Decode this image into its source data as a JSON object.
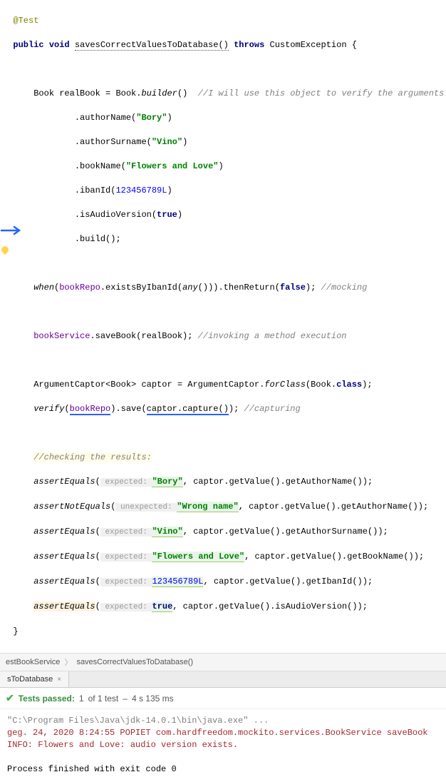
{
  "code": {
    "annotation": "@Test",
    "modifiers": "public void",
    "method_name": "savesCorrectValuesToDatabase()",
    "throws_kw": "throws",
    "exception": "CustomException",
    "brace_open": "{",
    "l1_a": "Book realBook = Book.",
    "l1_b": "builder",
    "l1_c": "()  ",
    "l1_comment": "//I will use this object to verify the arguments.",
    "l2_a": ".authorName(",
    "l2_str": "\"Bory\"",
    "l2_c": ")",
    "l3_a": ".authorSurname(",
    "l3_str": "\"Vino\"",
    "l3_c": ")",
    "l4_a": ".bookName(",
    "l4_str": "\"Flowers and Love\"",
    "l4_c": ")",
    "l5_a": ".ibanId(",
    "l5_num": "123456789L",
    "l5_c": ")",
    "l6_a": ".isAudioVersion(",
    "l6_bool": "true",
    "l6_c": ")",
    "l7_a": ".build();",
    "l8_a": "when",
    "l8_b": "(",
    "l8_repo": "bookRepo",
    "l8_c": ".existsByIbanId(",
    "l8_d": "any",
    "l8_e": "())).thenReturn(",
    "l8_bool": "false",
    "l8_f": "); ",
    "l8_comment": "//mocking",
    "l9_repo": "bookService",
    "l9_a": ".saveBook(realBook); ",
    "l9_comment": "//invoking a method execution",
    "l10_a": "ArgumentCaptor<Book> captor = ArgumentCaptor.",
    "l10_b": "forClass",
    "l10_c": "(Book.",
    "l10_d": "class",
    "l10_e": ");",
    "l11_a": "verify",
    "l11_b": "(",
    "l11_repo": "bookRepo",
    "l11_c": ").save(",
    "l11_d": "captor.capture()",
    "l11_e": "); ",
    "l11_comment": "//capturing",
    "l12_comment": "//checking the results:",
    "a1_m": "assertEquals",
    "a1_hint": " expected: ",
    "a1_str": "\"Bory\"",
    "a1_rest": ", captor.getValue().getAuthorName());",
    "a2_m": "assertNotEquals",
    "a2_hint": " unexpected: ",
    "a2_str": "\"Wrong name\"",
    "a2_rest": ", captor.getValue().getAuthorName());",
    "a3_m": "assertEquals",
    "a3_hint": " expected: ",
    "a3_str": "\"Vino\"",
    "a3_rest": ", captor.getValue().getAuthorSurname());",
    "a4_m": "assertEquals",
    "a4_hint": " expected: ",
    "a4_str": "\"Flowers and Love\"",
    "a4_rest": ", captor.getValue().getBookName());",
    "a5_m": "assertEquals",
    "a5_hint": " expected: ",
    "a5_num": "123456789L",
    "a5_rest": ", captor.getValue().getIbanId());",
    "a6_m": "assertEquals",
    "a6_hint": " expected: ",
    "a6_bool": "true",
    "a6_rest": ", captor.getValue().isAudioVersion());",
    "brace_close": "}",
    "open_paren": "("
  },
  "breadcrumb": {
    "item1": "estBookService",
    "chevron": "〉",
    "item2": "savesCorrectValuesToDatabase()"
  },
  "tab": {
    "label": "sToDatabase",
    "close": "×"
  },
  "test_status": {
    "check": "✔",
    "passed": "Tests passed:",
    "count": "1",
    "of": "of 1 test",
    "dash": "–",
    "time": "4 s 135 ms"
  },
  "console": {
    "cmd": "\"C:\\Program Files\\Java\\jdk-14.0.1\\bin\\java.exe\" ...",
    "log1": "geg. 24, 2020 8:24:55 POPIET com.hardfreedom.mockito.services.BookService saveBook",
    "log2": "INFO: Flowers and Love: audio version exists.",
    "exit": "Process finished with exit code 0"
  }
}
